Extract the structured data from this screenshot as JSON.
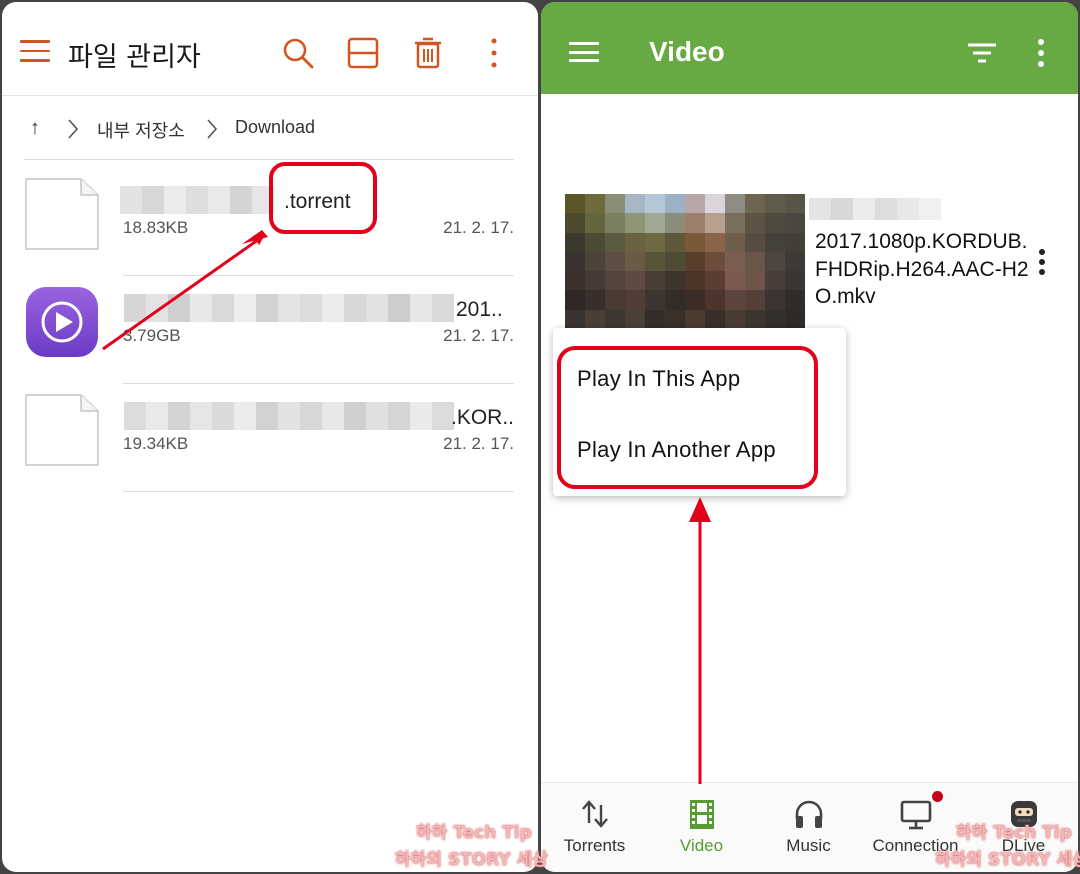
{
  "left_panel": {
    "title": "파일 관리자",
    "breadcrumb": {
      "up_icon": "↑",
      "root": "내부 저장소",
      "folder": "Download"
    },
    "files": [
      {
        "name_suffix": ".torrent",
        "size": "18.83KB",
        "date": "21. 2. 17.",
        "icon": "file-icon"
      },
      {
        "name_suffix": "201..",
        "size": "3.79GB",
        "date": "21. 2. 17.",
        "icon": "video-player-icon"
      },
      {
        "name_suffix": ".KOR..",
        "size": "19.34KB",
        "date": "21. 2. 17.",
        "icon": "file-icon"
      }
    ],
    "accent": "#d2551f"
  },
  "right_panel": {
    "title": "Video",
    "accent": "#67a942",
    "video": {
      "filename": "2017.1080p.KORDUB.FHDRip.H264.AAC-H2O.mkv"
    },
    "popup": {
      "play_this": "Play In This App",
      "play_another": "Play In Another App"
    },
    "nav": {
      "torrents": "Torrents",
      "video": "Video",
      "music": "Music",
      "connection": "Connection",
      "dlive": "DLive"
    }
  },
  "watermark": {
    "line1": "하하 Tech Tip",
    "line2": "하하의 STORY 세상"
  },
  "annotation_color": "#e3001b"
}
